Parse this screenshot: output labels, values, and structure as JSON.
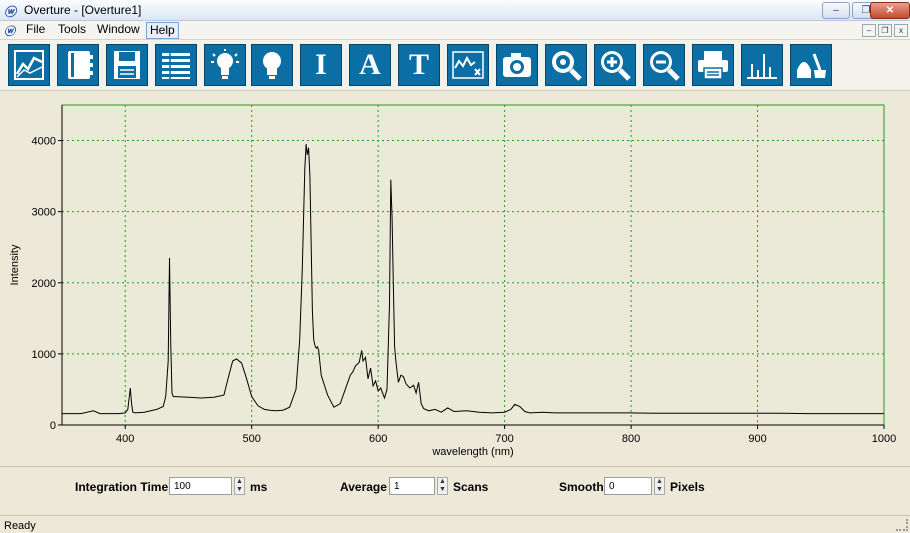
{
  "window": {
    "title": "Overture - [Overture1]",
    "logo_glyph": "ⓦ",
    "controls": {
      "minimize": "–",
      "restore": "❐",
      "close": "✕"
    },
    "mdi_controls": {
      "minimize": "–",
      "restore": "❐",
      "close": "x"
    }
  },
  "menu": {
    "items": [
      {
        "label": "File"
      },
      {
        "label": "Tools"
      },
      {
        "label": "Window"
      },
      {
        "label": "Help"
      }
    ]
  },
  "toolbar": {
    "accent": "#0b6fa6",
    "buttons": [
      {
        "icon": "chart-line-icon"
      },
      {
        "icon": "notebook-icon"
      },
      {
        "icon": "save-icon"
      },
      {
        "icon": "list-icon"
      },
      {
        "icon": "bulb-on-icon"
      },
      {
        "icon": "bulb-icon"
      },
      {
        "icon": "text-i-icon",
        "glyph": "I"
      },
      {
        "icon": "text-a-icon",
        "glyph": "A"
      },
      {
        "icon": "text-t-icon",
        "glyph": "T"
      },
      {
        "icon": "waveform-x-icon"
      },
      {
        "icon": "camera-icon"
      },
      {
        "icon": "zoom-fit-icon"
      },
      {
        "icon": "zoom-in-icon"
      },
      {
        "icon": "zoom-out-icon"
      },
      {
        "icon": "printer-icon"
      },
      {
        "icon": "peaks-icon"
      },
      {
        "icon": "cleanup-icon"
      }
    ]
  },
  "chart_data": {
    "type": "line",
    "title": "",
    "xlabel": "wavelength (nm)",
    "ylabel": "Intensity",
    "xlim": [
      350,
      1000
    ],
    "ylim": [
      0,
      4500
    ],
    "xticks": [
      400,
      500,
      600,
      700,
      800,
      900,
      1000
    ],
    "yticks": [
      0,
      1000,
      2000,
      3000,
      4000
    ],
    "grid": true,
    "grid_color": "#1ea01e",
    "background": "#ebe9d7",
    "series": [
      {
        "color": "#000000",
        "x": [
          350,
          365,
          375,
          380,
          395,
          400,
          402,
          404,
          405,
          406,
          408,
          415,
          425,
          430,
          432,
          434,
          435,
          436,
          437,
          438,
          440,
          450,
          460,
          470,
          478,
          482,
          485,
          488,
          492,
          496,
          500,
          505,
          510,
          515,
          520,
          525,
          530,
          535,
          538,
          540,
          542,
          543,
          544,
          545,
          546,
          547,
          548,
          549,
          550,
          551,
          552,
          553,
          555,
          560,
          565,
          570,
          575,
          578,
          580,
          582,
          585,
          587,
          588,
          590,
          592,
          594,
          596,
          598,
          600,
          602,
          605,
          607,
          609,
          610,
          611,
          612,
          613,
          614,
          615,
          616,
          618,
          620,
          622,
          625,
          628,
          630,
          632,
          634,
          636,
          640,
          645,
          650,
          655,
          660,
          670,
          680,
          690,
          700,
          705,
          708,
          712,
          716,
          720,
          730,
          740,
          760,
          780,
          800,
          820,
          840,
          860,
          880,
          900,
          920,
          940,
          960,
          980,
          1000
        ],
        "y": [
          160,
          160,
          200,
          160,
          160,
          170,
          220,
          520,
          300,
          180,
          170,
          180,
          220,
          260,
          400,
          900,
          2350,
          1100,
          450,
          400,
          400,
          390,
          380,
          390,
          420,
          700,
          900,
          930,
          870,
          650,
          400,
          270,
          220,
          205,
          200,
          210,
          250,
          500,
          1200,
          2200,
          3600,
          3950,
          3800,
          3900,
          3500,
          2600,
          1600,
          1200,
          1120,
          1080,
          1100,
          1050,
          700,
          420,
          250,
          300,
          550,
          700,
          750,
          830,
          880,
          1050,
          900,
          950,
          650,
          800,
          550,
          620,
          480,
          520,
          380,
          500,
          1700,
          3450,
          2900,
          2000,
          1100,
          900,
          750,
          600,
          700,
          680,
          580,
          520,
          560,
          450,
          600,
          300,
          230,
          200,
          220,
          180,
          240,
          190,
          200,
          180,
          170,
          180,
          220,
          290,
          260,
          190,
          170,
          180,
          170,
          170,
          170,
          170,
          165,
          165,
          165,
          165,
          165,
          165,
          160,
          160,
          160,
          160
        ]
      }
    ]
  },
  "controls": {
    "integration_time": {
      "label": "Integration Time",
      "value": "100",
      "unit": "ms"
    },
    "average": {
      "label": "Average",
      "value": "1",
      "unit": "Scans"
    },
    "smooth": {
      "label": "Smooth",
      "value": "0",
      "unit": "Pixels"
    }
  },
  "status": {
    "text": "Ready"
  }
}
